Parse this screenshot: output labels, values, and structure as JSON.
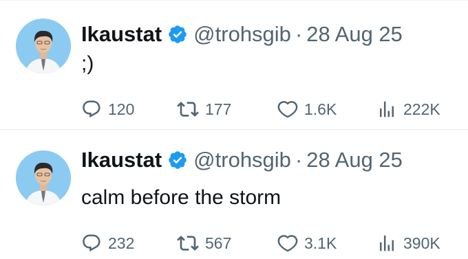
{
  "tweets": [
    {
      "author_name": "Ikaustat",
      "handle": "@trohsgib",
      "separator": "·",
      "date": "28 Aug 25",
      "text": ";)",
      "replies": "120",
      "retweets": "177",
      "likes": "1.6K",
      "views": "222K"
    },
    {
      "author_name": "Ikaustat",
      "handle": "@trohsgib",
      "separator": "·",
      "date": "28 Aug 25",
      "text": "calm before the storm",
      "replies": "232",
      "retweets": "567",
      "likes": "3.1K",
      "views": "390K"
    }
  ],
  "icons": {
    "verified": "verified-badge-icon",
    "reply": "reply-icon",
    "retweet": "retweet-icon",
    "like": "heart-icon",
    "views": "views-chart-icon"
  },
  "colors": {
    "text_primary": "#0f1419",
    "text_secondary": "#536471",
    "verified_blue": "#1d9bf0",
    "avatar_background": "#8ccbf1",
    "divider": "#e6ecf0"
  }
}
